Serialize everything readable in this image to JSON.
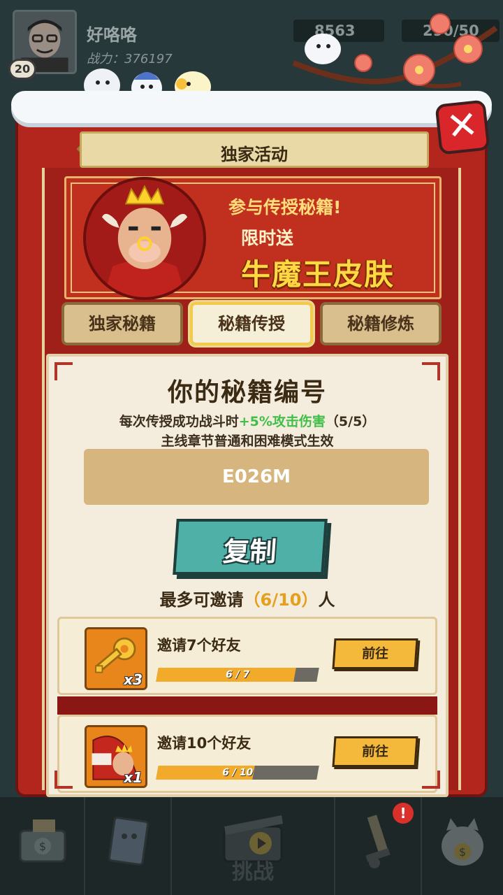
{
  "player": {
    "level": "20",
    "name": "好咯咯",
    "power_label": "战力：376197"
  },
  "resources": {
    "coins": "8563",
    "energy": "290/50"
  },
  "modal": {
    "title": "独家活动",
    "close_icon": "close-x-icon",
    "banner": {
      "line1": "参与传授秘籍!",
      "line2": "限时送",
      "line3": "牛魔王皮肤"
    },
    "tabs": [
      {
        "label": "独家秘籍",
        "active": false
      },
      {
        "label": "秘籍传授",
        "active": true
      },
      {
        "label": "秘籍修炼",
        "active": false
      }
    ],
    "panel": {
      "title": "你的秘籍编号",
      "desc1_prefix": "每次传授成功战斗时",
      "desc1_bonus": "+5%攻击伤害",
      "desc1_suffix": "（5/5）",
      "desc2": "主线章节普通和困难模式生效",
      "code": "E026M",
      "copy_label": "复制",
      "invite_prefix": "最多可邀请",
      "invite_count": "（6/10）",
      "invite_suffix": "人"
    },
    "rewards": [
      {
        "title": "邀请7个好友",
        "qty": "x3",
        "progress_text": "6 / 7",
        "progress": 0.857,
        "go_label": "前往",
        "icon": "key-icon"
      },
      {
        "title": "邀请10个好友",
        "qty": "x1",
        "progress_text": "6 / 10",
        "progress": 0.6,
        "go_label": "前往",
        "icon": "bull-king-skin-icon"
      }
    ]
  },
  "bottom_nav": {
    "challenge_label": "挑战",
    "notif": "!"
  },
  "colors": {
    "frame_red": "#b3261e",
    "gold": "#ffd843",
    "teal_button": "#4fb0a8",
    "bonus_green": "#3fbf48"
  }
}
